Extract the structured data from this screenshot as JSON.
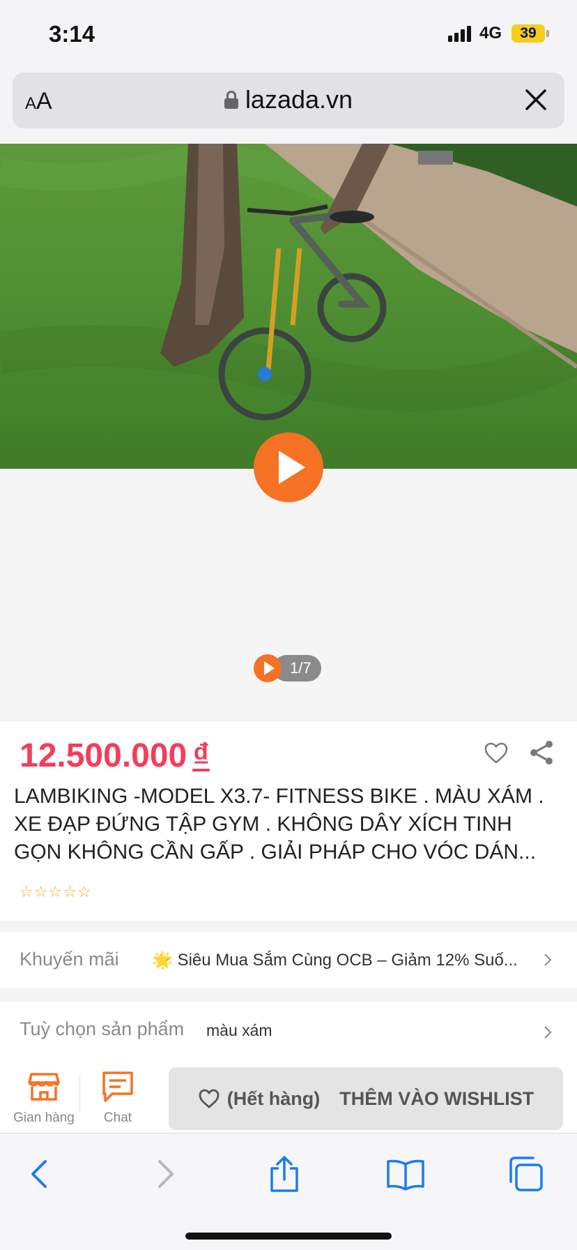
{
  "status_bar": {
    "time": "3:14",
    "network": "4G",
    "battery": "39"
  },
  "browser": {
    "aa_small": "A",
    "aa_big": "A",
    "url": "lazada.vn"
  },
  "media": {
    "counter": "1/7"
  },
  "product": {
    "price": "12.500.000",
    "currency": "₫",
    "title": "LAMBIKING -MODEL X3.7- FITNESS BIKE . MÀU XÁM . XE ĐẠP ĐỨNG TẬP GYM . KHÔNG DÂY XÍCH TINH GỌN KHÔNG CẦN GẤP . GIẢI PHÁP CHO VÓC DÁN...",
    "stars": [
      "☆",
      "☆",
      "☆",
      "☆",
      "☆"
    ]
  },
  "promotion": {
    "label": "Khuyến mãi",
    "emoji": "🌟",
    "text": "Siêu Mua Sắm Cùng OCB – Giảm 12% Suố..."
  },
  "options": {
    "label": "Tuỳ chọn sản phẩm",
    "value": "màu xám"
  },
  "action_bar": {
    "shop_label": "Gian hàng",
    "chat_label": "Chat",
    "wishlist_status": "(Hết hàng)",
    "wishlist_label": "THÊM VÀO WISHLIST"
  },
  "colors": {
    "accent": "#f57224",
    "price": "#f53d5a",
    "ios_blue": "#1a7cf5"
  }
}
